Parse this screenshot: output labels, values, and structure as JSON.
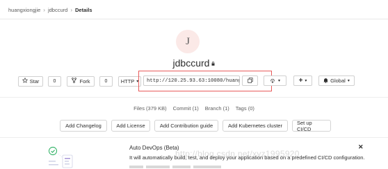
{
  "breadcrumb": {
    "items": [
      "huangxiongjie",
      "jdbccurd",
      "Details"
    ]
  },
  "project": {
    "avatar_letter": "J",
    "name": "jdbccurd"
  },
  "actions": {
    "star_label": "Star",
    "star_count": "0",
    "fork_label": "Fork",
    "fork_count": "0",
    "protocol_label": "HTTP",
    "clone_url": "http://120.25.93.63:10080/huangx",
    "notification_label": "Global"
  },
  "stats": {
    "files": "Files (379 KB)",
    "commit": "Commit (1)",
    "branch": "Branch (1)",
    "tags": "Tags (0)"
  },
  "quick_actions": [
    "Add Changelog",
    "Add License",
    "Add Contribution guide",
    "Add Kubernetes cluster",
    "Set up CI/CD"
  ],
  "autodevops": {
    "title": "Auto DevOps (Beta)",
    "description": "It will automatically build, test, and deploy your application based on a predefined CI/CD configuration."
  },
  "watermark": "http://blog.csdn.net/xyz1995920",
  "colors": {
    "highlight": "#e85a5a",
    "avatar_bg": "#fbe9e7",
    "success_green": "#1aaa55"
  }
}
